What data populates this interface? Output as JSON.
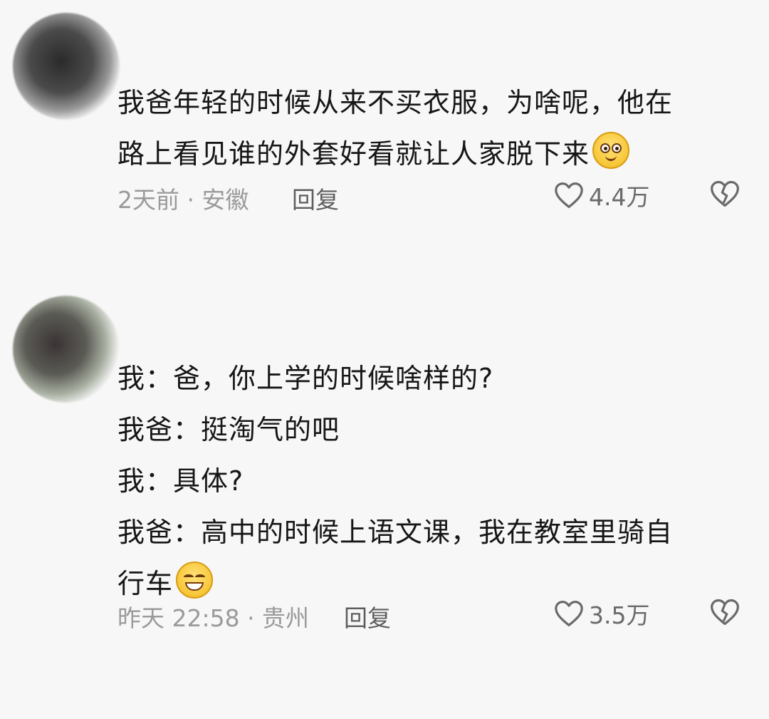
{
  "comments": [
    {
      "lines": [
        "我爸年轻的时候从来不买衣服，为啥呢，他在",
        "路上看见谁的外套好看就让人家脱下来"
      ],
      "emoji": "smiling-face-emoji",
      "time_location": "2天前 · 安徽",
      "reply_label": "回复",
      "like_count": "4.4万"
    },
    {
      "lines": [
        "我：爸，你上学的时候啥样的?",
        "我爸：挺淘气的吧",
        "我：具体?",
        "我爸：高中的时候上语文课，我在教室里骑自",
        "行车"
      ],
      "emoji": "grinning-face-emoji",
      "time_location": "昨天 22:58 · 贵州",
      "reply_label": "回复",
      "like_count": "3.5万"
    }
  ],
  "icons": {
    "like": "heart-outline-icon",
    "dislike": "broken-heart-icon"
  },
  "colors": {
    "text": "#161616",
    "meta": "#9a9a9a",
    "reply": "#5e5e5e",
    "emoji": "#f7c637"
  }
}
